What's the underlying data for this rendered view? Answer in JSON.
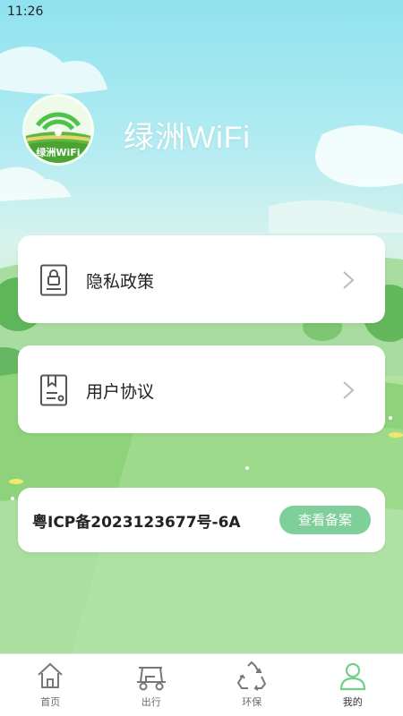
{
  "status_bar": {
    "time": "11:26"
  },
  "header": {
    "app_name": "绿洲WiFi",
    "logo_text": "绿洲WiFi"
  },
  "menu": [
    {
      "label": "隐私政策",
      "icon": "lock-document-icon"
    },
    {
      "label": "用户协议",
      "icon": "agreement-document-icon"
    }
  ],
  "icp": {
    "number": "粤ICP备2023123677号-6A",
    "button_label": "查看备案"
  },
  "tabs": [
    {
      "label": "首页",
      "icon": "home-icon",
      "active": false
    },
    {
      "label": "出行",
      "icon": "golf-cart-icon",
      "active": false
    },
    {
      "label": "环保",
      "icon": "recycle-icon",
      "active": false
    },
    {
      "label": "我的",
      "icon": "user-icon",
      "active": true
    }
  ],
  "colors": {
    "accent": "#7ecf99",
    "active_tab": "#6fd08a"
  }
}
